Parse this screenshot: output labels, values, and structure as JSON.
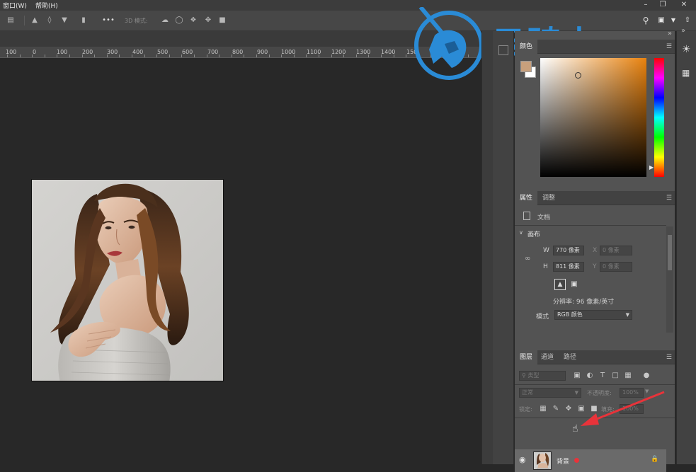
{
  "menubar": {
    "items": [
      "窗口(W)",
      "帮助(H)"
    ],
    "window_controls": [
      "minimize-icon",
      "restore-icon",
      "close-icon"
    ]
  },
  "options_bar": {
    "mode_3d_label": "3D 模式:",
    "more_label": "•••"
  },
  "ruler": {
    "ticks": [
      "100",
      "0",
      "100",
      "200",
      "300",
      "400",
      "500",
      "600",
      "700",
      "800",
      "900",
      "1000",
      "1100",
      "1200",
      "1300",
      "1400",
      "150"
    ]
  },
  "watermark": {
    "text": "云骑士"
  },
  "color_panel": {
    "tabs": [
      "颜色"
    ],
    "foreground": "#c8a07c",
    "background": "#ffffff",
    "hue": "#e8820e"
  },
  "properties_panel": {
    "tabs": [
      "属性",
      "调整"
    ],
    "doc_label": "文档",
    "canvas_section": "画布",
    "w_label": "W",
    "w_value": "770 像素",
    "h_label": "H",
    "h_value": "811 像素",
    "x_label": "X",
    "x_placeholder": "0 像素",
    "y_label": "Y",
    "y_placeholder": "0 像素",
    "resolution": "分辨率: 96 像素/英寸",
    "mode_label": "模式",
    "mode_value": "RGB 颜色"
  },
  "layers_panel": {
    "tabs": [
      "图层",
      "通道",
      "路径"
    ],
    "filter_placeholder": "类型",
    "blend_mode": "正常",
    "opacity_label": "不透明度:",
    "opacity_value": "100%",
    "lock_label": "锁定:",
    "fill_label": "填充:",
    "fill_value": "100%",
    "layers": [
      {
        "name": "背景",
        "visible": true,
        "locked": true
      }
    ]
  },
  "accent_colors": {
    "arrow": "#e8333a",
    "watermark": "#2a8bd6"
  }
}
